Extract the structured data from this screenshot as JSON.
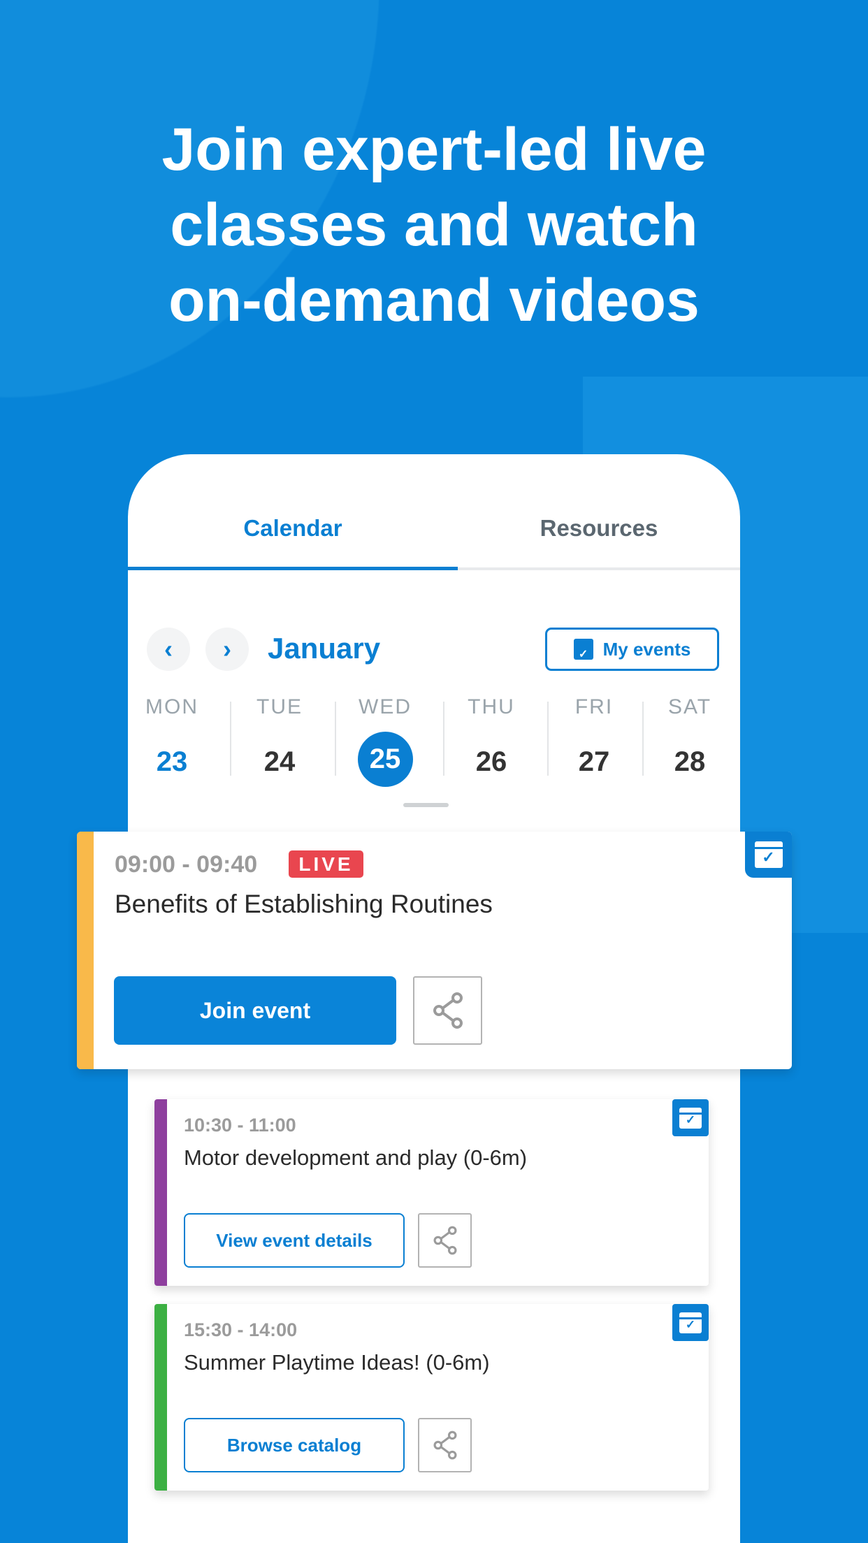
{
  "headline": [
    "Join expert-led live",
    "classes and watch",
    "on-demand videos"
  ],
  "tabs": {
    "calendar": "Calendar",
    "resources": "Resources"
  },
  "nav": {
    "prev": "‹",
    "next": "›",
    "month": "January",
    "my_events": "My events"
  },
  "days": [
    {
      "name": "MON",
      "num": "23"
    },
    {
      "name": "TUE",
      "num": "24"
    },
    {
      "name": "WED",
      "num": "25"
    },
    {
      "name": "THU",
      "num": "26"
    },
    {
      "name": "FRI",
      "num": "27"
    },
    {
      "name": "SAT",
      "num": "28"
    }
  ],
  "events": [
    {
      "time": "09:00 - 09:40",
      "badge": "LIVE",
      "title": "Benefits of Establishing Routines",
      "button": "Join event",
      "color": "#f9b94a"
    },
    {
      "time": "10:30 - 11:00",
      "title": "Motor development and play (0-6m)",
      "button": "View event details",
      "color": "#8e3f9e"
    },
    {
      "time": "15:30 - 14:00",
      "title": "Summer Playtime Ideas! (0-6m)",
      "button": "Browse catalog",
      "color": "#3cb043"
    }
  ],
  "colors": {
    "background": "#0784d8",
    "accent": "#0a7fd2",
    "live": "#e9464f"
  }
}
